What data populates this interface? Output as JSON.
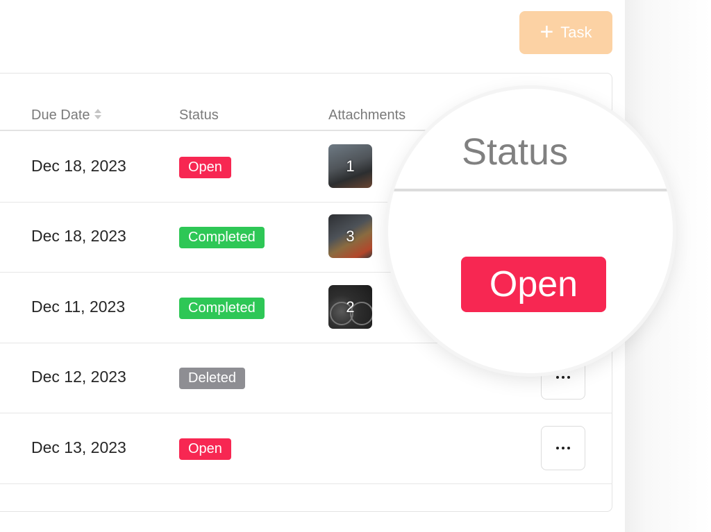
{
  "toolbar": {
    "add_task_label": "Task",
    "add_icon": "plus-icon"
  },
  "table": {
    "columns": {
      "due_date": "Due Date",
      "status": "Status",
      "attachments": "Attachments"
    },
    "rows": [
      {
        "due_date": "Dec 18, 2023",
        "status": "Open",
        "attachment_count": "1"
      },
      {
        "due_date": "Dec 18, 2023",
        "status": "Completed",
        "attachment_count": "3"
      },
      {
        "due_date": "Dec 11, 2023",
        "status": "Completed",
        "attachment_count": "2"
      },
      {
        "due_date": "Dec 12, 2023",
        "status": "Deleted",
        "attachment_count": ""
      },
      {
        "due_date": "Dec 13, 2023",
        "status": "Open",
        "attachment_count": ""
      }
    ]
  },
  "magnifier": {
    "title": "Status",
    "badge": "Open"
  },
  "colors": {
    "open": "#f72752",
    "completed": "#2ec756",
    "deleted": "#8e8e93",
    "accent": "#fcd2a4"
  }
}
